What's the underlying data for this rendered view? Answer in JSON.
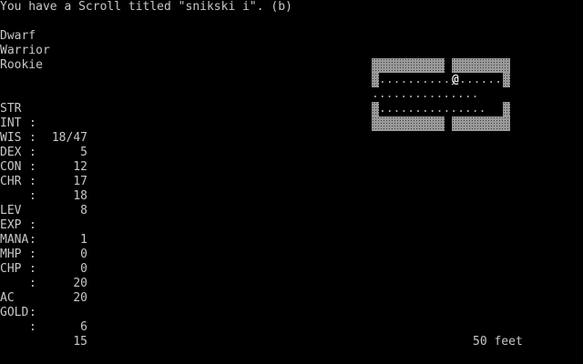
{
  "message": "You have a Scroll titled \"snikski i\". (b)",
  "character": {
    "race": "Dwarf",
    "class": "Warrior",
    "title": "Rookie"
  },
  "stats": [
    {
      "label": "STR",
      "sep": ":",
      "value": "18/47"
    },
    {
      "label": "INT",
      "sep": ":",
      "value": "5"
    },
    {
      "label": "WIS",
      "sep": ":",
      "value": "12"
    },
    {
      "label": "DEX",
      "sep": ":",
      "value": "17"
    },
    {
      "label": "CON",
      "sep": ":",
      "value": "18"
    },
    {
      "label": "CHR",
      "sep": ":",
      "value": "8"
    }
  ],
  "status": [
    {
      "label": "LEV",
      "sep": ":",
      "value": "1"
    },
    {
      "label": "EXP",
      "sep": ":",
      "value": "0"
    },
    {
      "label": "MANA",
      "sep": ":",
      "value": "0"
    },
    {
      "label": "MHP",
      "sep": ":",
      "value": "20"
    },
    {
      "label": "CHP",
      "sep": ":",
      "value": "20"
    }
  ],
  "equipment": [
    {
      "label": "AC",
      "sep": ":",
      "value": "6"
    },
    {
      "label": "GOLD",
      "sep": ":",
      "value": "15"
    }
  ],
  "map": {
    "row1": "...........",
    "row1b": "......",
    "hero": "@",
    "row2": "...............",
    "row3": "..............."
  },
  "depth": "50 feet"
}
